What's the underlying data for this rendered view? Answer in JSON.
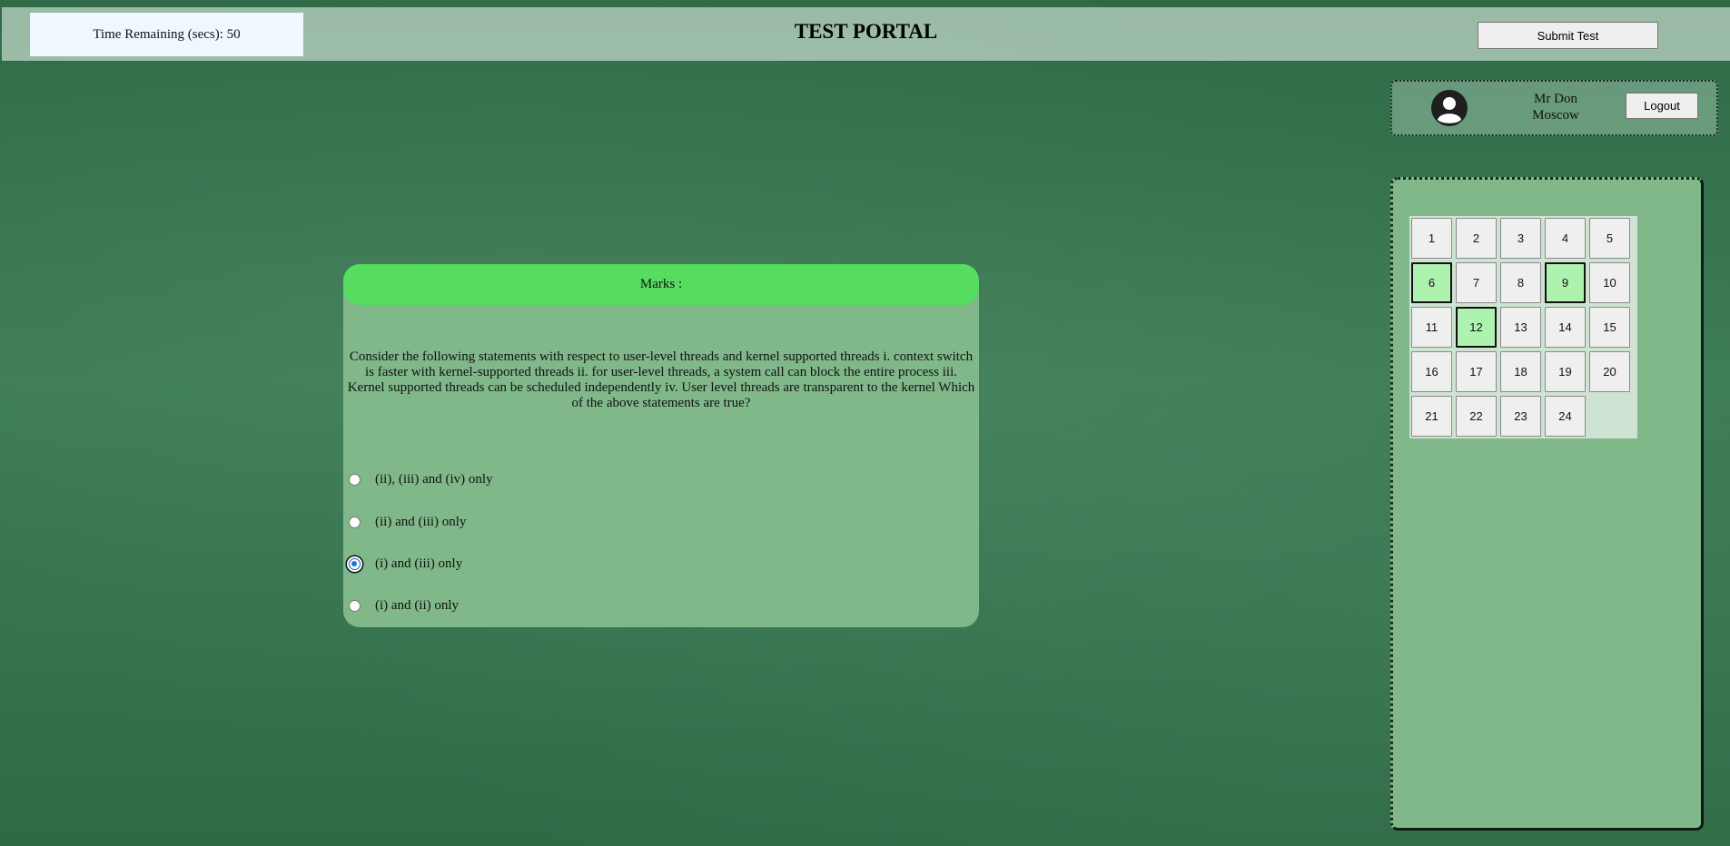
{
  "header": {
    "timer_text": "Time Remaining (secs): 50",
    "title": "TEST PORTAL",
    "submit_label": "Submit Test"
  },
  "user": {
    "avatar_icon": "user-avatar-icon",
    "name_line1": "Mr Don",
    "name_line2": "Moscow",
    "logout_label": "Logout"
  },
  "question": {
    "marks_label": "Marks :",
    "text": "Consider the following statements with respect to user-level threads and kernel supported threads i. context switch is faster with kernel-supported threads ii. for user-level threads, a system call can block the entire process iii. Kernel supported threads can be scheduled independently iv. User level threads are transparent to the kernel Which of the above statements are true?",
    "options": [
      {
        "label": "(ii), (iii) and (iv) only",
        "selected": false
      },
      {
        "label": "(ii) and (iii) only",
        "selected": false
      },
      {
        "label": "(i) and (iii) only",
        "selected": true
      },
      {
        "label": "(i) and (ii) only",
        "selected": false
      }
    ]
  },
  "navigator": {
    "questions": [
      "1",
      "2",
      "3",
      "4",
      "5",
      "6",
      "7",
      "8",
      "9",
      "10",
      "11",
      "12",
      "13",
      "14",
      "15",
      "16",
      "17",
      "18",
      "19",
      "20",
      "21",
      "22",
      "23",
      "24"
    ],
    "answered": [
      "6",
      "9",
      "12"
    ]
  },
  "colors": {
    "background": "#32704b",
    "panel": "#80b889",
    "marks_bar": "#56dc5e",
    "answered": "#aef2b0"
  }
}
